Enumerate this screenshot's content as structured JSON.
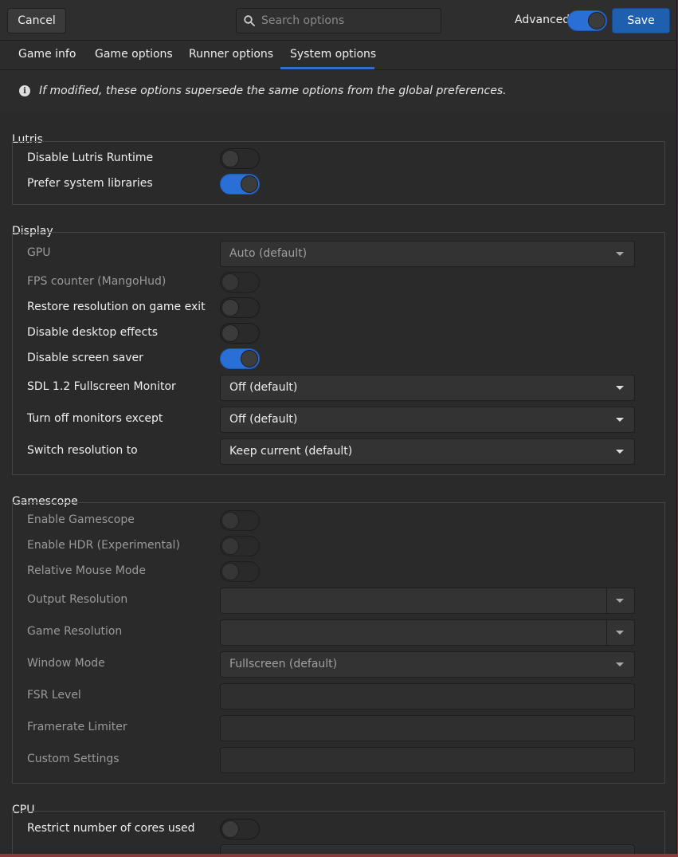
{
  "header": {
    "cancel_label": "Cancel",
    "save_label": "Save",
    "search_placeholder": "Search options",
    "advanced_label": "Advanced",
    "advanced_on": true
  },
  "tabs": [
    {
      "label": "Game info"
    },
    {
      "label": "Game options"
    },
    {
      "label": "Runner options"
    },
    {
      "label": "System options",
      "active": true
    }
  ],
  "info": {
    "text": "If modified, these options supersede the same options from the global preferences."
  },
  "sections": {
    "lutris": {
      "title": "Lutris",
      "rows": [
        {
          "label": "Disable Lutris Runtime",
          "on": false
        },
        {
          "label": "Prefer system libraries",
          "on": true
        }
      ]
    },
    "display": {
      "title": "Display",
      "gpu": {
        "label": "GPU",
        "value": "Auto (default)"
      },
      "fps": {
        "label": "FPS counter (MangoHud)",
        "on": false
      },
      "restore": {
        "label": "Restore resolution on game exit",
        "on": false
      },
      "desktop_effects": {
        "label": "Disable desktop effects",
        "on": false
      },
      "screen_saver": {
        "label": "Disable screen saver",
        "on": true
      },
      "sdl_monitor": {
        "label": "SDL 1.2 Fullscreen Monitor",
        "value": "Off (default)"
      },
      "monitors_except": {
        "label": "Turn off monitors except",
        "value": "Off (default)"
      },
      "switch_resolution": {
        "label": "Switch resolution to",
        "value": "Keep current (default)"
      }
    },
    "gamescope": {
      "title": "Gamescope",
      "enable": {
        "label": "Enable Gamescope",
        "on": false
      },
      "hdr": {
        "label": "Enable HDR (Experimental)",
        "on": false
      },
      "mouse": {
        "label": "Relative Mouse Mode",
        "on": false
      },
      "output_res": {
        "label": "Output Resolution",
        "value": ""
      },
      "game_res": {
        "label": "Game Resolution",
        "value": ""
      },
      "window_mode": {
        "label": "Window Mode",
        "value": "Fullscreen (default)"
      },
      "fsr": {
        "label": "FSR Level",
        "value": ""
      },
      "framerate": {
        "label": "Framerate Limiter",
        "value": ""
      },
      "custom": {
        "label": "Custom Settings",
        "value": ""
      }
    },
    "cpu": {
      "title": "CPU",
      "restrict": {
        "label": "Restrict number of cores used",
        "on": false
      }
    }
  }
}
